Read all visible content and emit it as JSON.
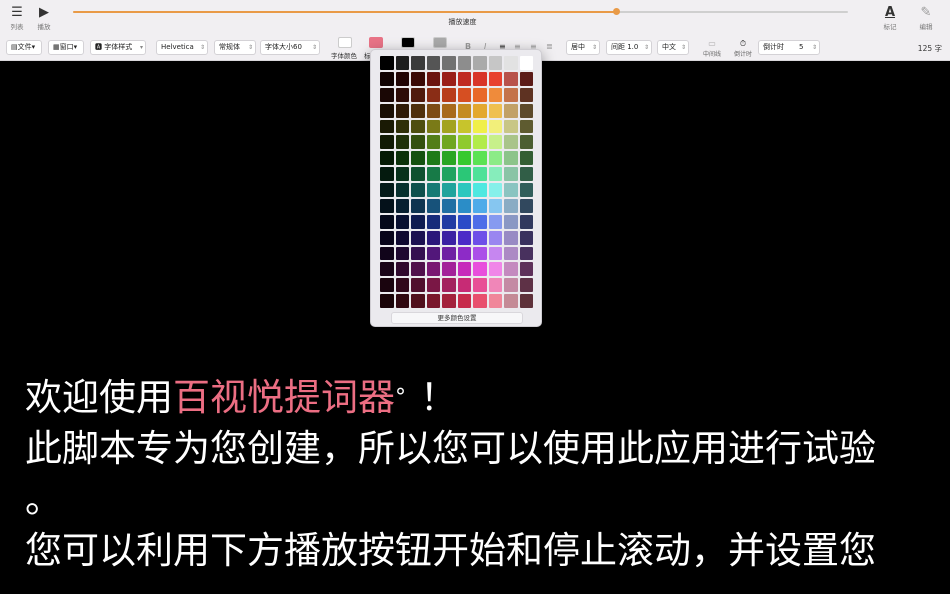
{
  "topbar": {
    "list_label": "列表",
    "play_label": "播放",
    "speed_label": "播放速度",
    "speed_value": 0.7,
    "mark_label": "标记",
    "edit_label": "编辑"
  },
  "toolbar": {
    "file": "文件",
    "window": "窗口",
    "font_style": "字体样式",
    "font_name": "Helvetica",
    "font_weight": "常规体",
    "font_size": "字体大小60",
    "font_color_label": "字体颜色",
    "bg_color_label": "标",
    "line_align": "居中",
    "line_spacing": "间距 1.0",
    "language": "中文",
    "midline_label": "中间线",
    "countdown_label": "倒计时",
    "countdown_field_label": "倒计时",
    "countdown_value": "5",
    "wpm": "125 字",
    "colors": {
      "font": "#ffffff",
      "highlight": "#e87386",
      "black": "#000000",
      "gray": "#a9a9a9"
    }
  },
  "color_picker": {
    "more_label": "更多颜色设置",
    "grid": [
      [
        "#000000",
        "#1e1e1e",
        "#3a3a3a",
        "#555555",
        "#717171",
        "#8d8d8d",
        "#aaaaaa",
        "#c6c6c6",
        "#e2e2e2",
        "#ffffff"
      ],
      [
        "#100202",
        "#200404",
        "#3a0906",
        "#6b1410",
        "#9a1e18",
        "#c02a22",
        "#d83428",
        "#e8412f",
        "#b8524b",
        "#5b1b18"
      ],
      [
        "#1a0705",
        "#2d0c07",
        "#4f1a0d",
        "#8a2d16",
        "#b83d1b",
        "#d64f22",
        "#e86829",
        "#ef8b3b",
        "#c4734b",
        "#5e3222"
      ],
      [
        "#1a0f04",
        "#2f1b07",
        "#4f300d",
        "#7d4c15",
        "#a86a1c",
        "#c48c22",
        "#e3a82f",
        "#efc04f",
        "#c2a166",
        "#5d4a2b"
      ],
      [
        "#1a1a04",
        "#2f2f08",
        "#4e4e0f",
        "#7a7a17",
        "#a3a321",
        "#c7c42c",
        "#f0ef4a",
        "#f2ef7a",
        "#c8c685",
        "#5e5b30"
      ],
      [
        "#111a04",
        "#1f3009",
        "#34500f",
        "#537d18",
        "#70a622",
        "#8fca2d",
        "#b2eb4a",
        "#c7f08a",
        "#a9c48a",
        "#4b5e31"
      ],
      [
        "#051a04",
        "#0b3009",
        "#14500f",
        "#1f7a18",
        "#2aa523",
        "#37c92f",
        "#5ce254",
        "#8ceb87",
        "#8cc48a",
        "#335e33"
      ],
      [
        "#041a0e",
        "#08301b",
        "#0f502f",
        "#177a47",
        "#21a360",
        "#2bc777",
        "#4fe199",
        "#86edbb",
        "#8ac4a6",
        "#315e47"
      ],
      [
        "#041a19",
        "#08302e",
        "#0f504d",
        "#177a74",
        "#21a39c",
        "#2bc7be",
        "#4fe8e0",
        "#86f0ea",
        "#8ac4c1",
        "#315e5b"
      ],
      [
        "#04111a",
        "#081f30",
        "#0f3450",
        "#17527a",
        "#216fa3",
        "#2b8dc7",
        "#4fabe9",
        "#86c6f0",
        "#8aacc4",
        "#31485e"
      ],
      [
        "#04081a",
        "#080f30",
        "#0f1b50",
        "#172b7a",
        "#213ba3",
        "#2b4bc7",
        "#4f6ee8",
        "#869af0",
        "#8a98c4",
        "#31395e"
      ],
      [
        "#08041a",
        "#0f0830",
        "#1b0f50",
        "#2b177a",
        "#3b21a3",
        "#4b2bc7",
        "#6e4fe8",
        "#9a86f0",
        "#988ac4",
        "#39315e"
      ],
      [
        "#11041a",
        "#1f0830",
        "#340f50",
        "#52177a",
        "#6f21a3",
        "#8d2bc7",
        "#ab4fe8",
        "#c686f0",
        "#ac8ac4",
        "#48315e"
      ],
      [
        "#1a0418",
        "#30082d",
        "#500f4b",
        "#7a1772",
        "#a32199",
        "#c72bbb",
        "#e84fdc",
        "#f086e8",
        "#c48abf",
        "#5e315a"
      ],
      [
        "#1a040e",
        "#30081a",
        "#500f2d",
        "#7a1745",
        "#a3215e",
        "#c72b75",
        "#e84f96",
        "#f086b8",
        "#c48aa4",
        "#5e3146"
      ],
      [
        "#1a0408",
        "#300810",
        "#500f1c",
        "#7a172c",
        "#a3213c",
        "#c72b4c",
        "#e84f6e",
        "#f0869a",
        "#c48a96",
        "#5e313a"
      ]
    ]
  },
  "script": {
    "welcome": "欢迎使用",
    "app_name": "百视悦提词器",
    "reg_mark": "°",
    "exclaim": "！",
    "line2": "此脚本专为您创建，所以您可以使用此应用进行试验",
    "line3": "。",
    "line4": "您可以利用下方播放按钮开始和停止滚动，并设置您"
  }
}
